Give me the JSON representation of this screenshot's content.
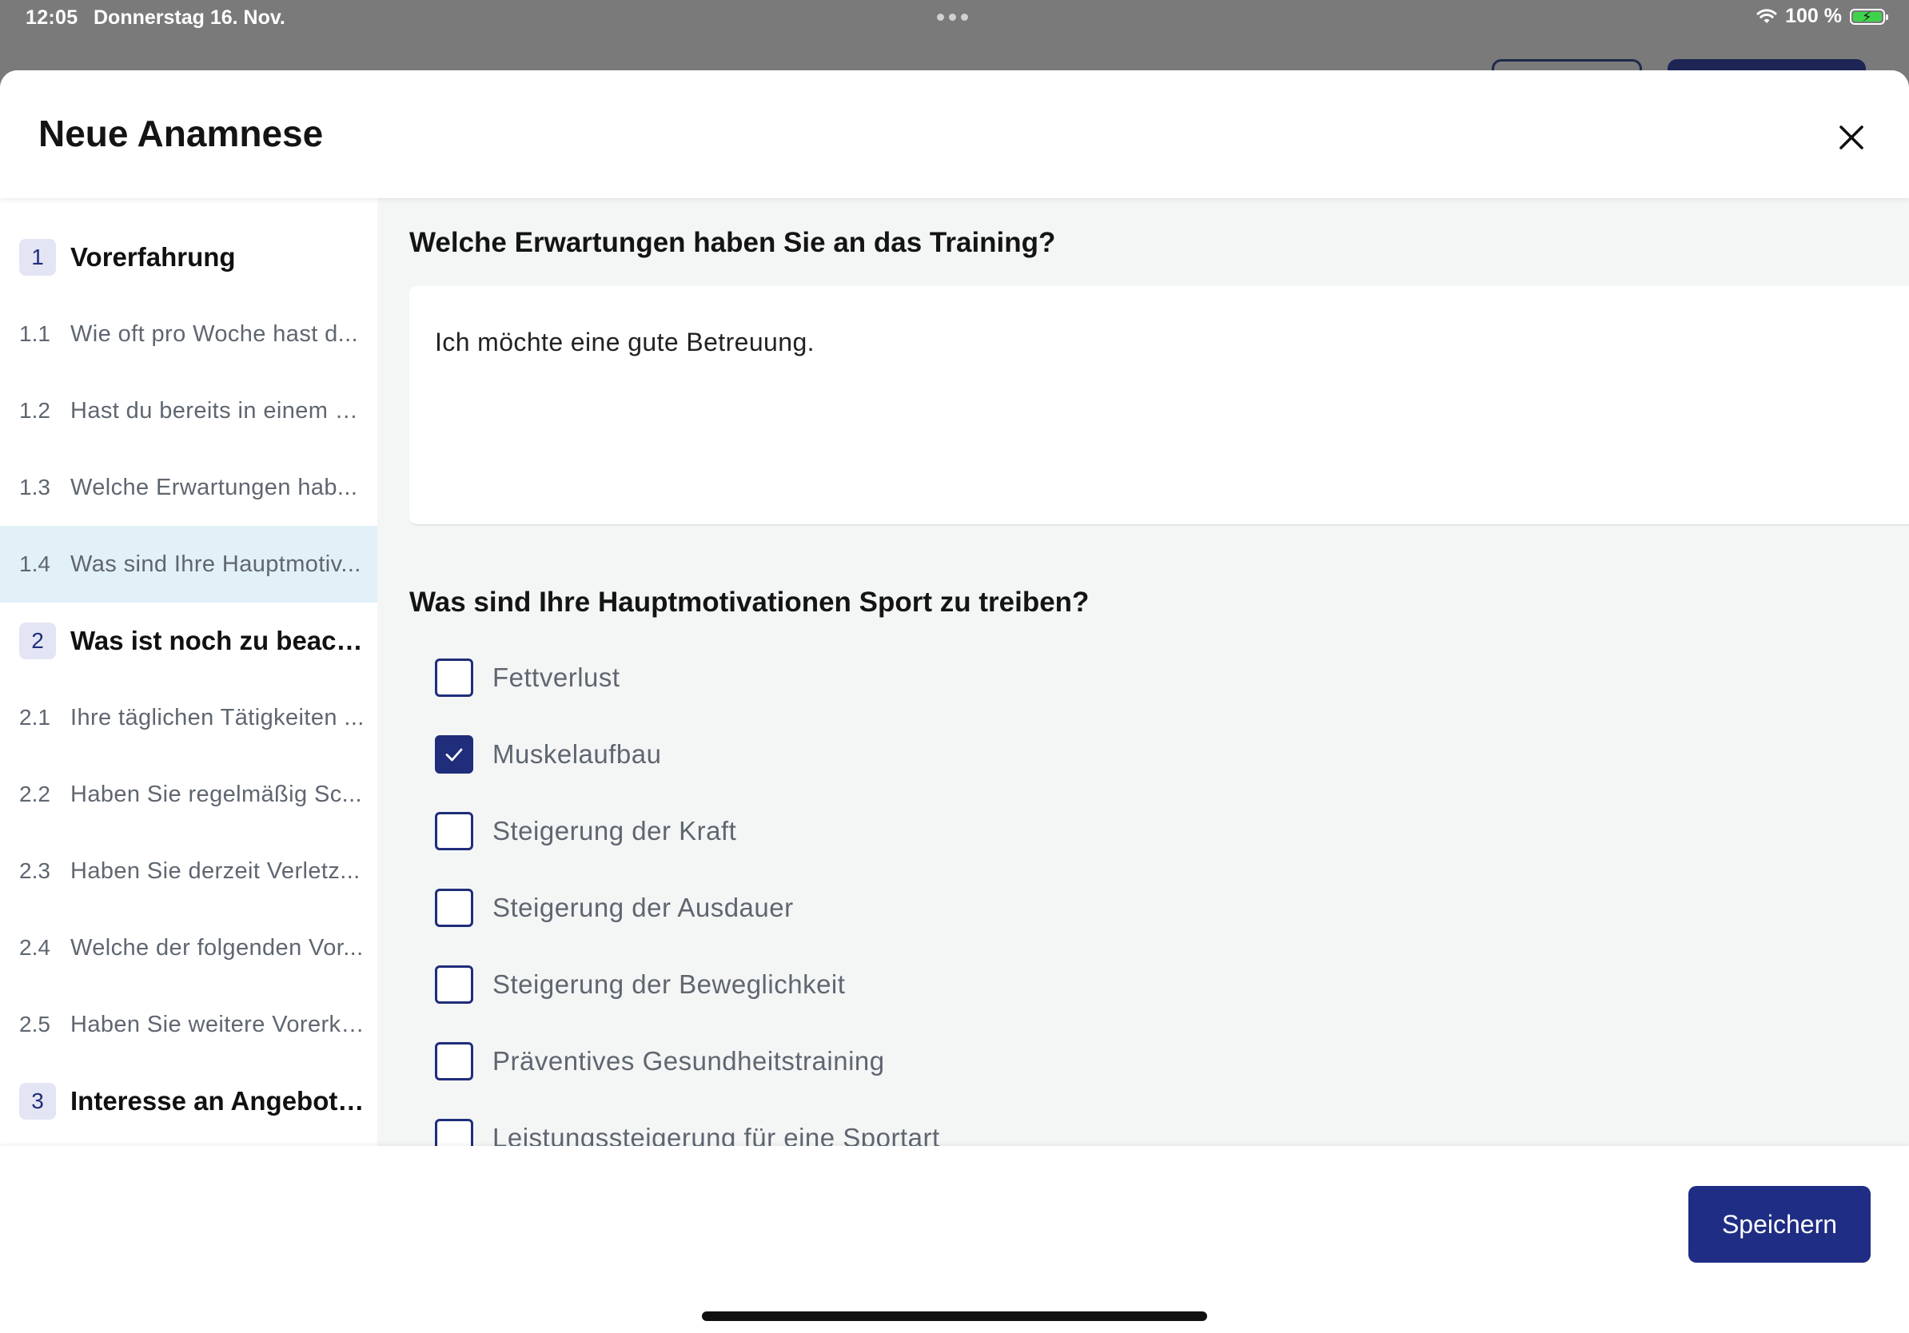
{
  "status_bar": {
    "time": "12:05",
    "date": "Donnerstag 16. Nov.",
    "battery_text": "100 %",
    "icons": [
      "wifi-icon",
      "battery-icon"
    ]
  },
  "sheet": {
    "title": "Neue Anamnese",
    "close_icon": "close-icon"
  },
  "sidebar": {
    "items": [
      {
        "kind": "section",
        "num": "1",
        "label": "Vorerfahrung"
      },
      {
        "kind": "question",
        "num": "1.1",
        "label": "Wie oft pro Woche hast d..."
      },
      {
        "kind": "question",
        "num": "1.2",
        "label": "Hast du bereits in einem F..."
      },
      {
        "kind": "question",
        "num": "1.3",
        "label": "Welche Erwartungen hab..."
      },
      {
        "kind": "question",
        "num": "1.4",
        "label": "Was sind Ihre Hauptmotiv...",
        "active": true
      },
      {
        "kind": "section",
        "num": "2",
        "label": "Was ist noch zu beachten"
      },
      {
        "kind": "question",
        "num": "2.1",
        "label": "Ihre täglichen Tätigkeiten ..."
      },
      {
        "kind": "question",
        "num": "2.2",
        "label": "Haben Sie regelmäßig Sc..."
      },
      {
        "kind": "question",
        "num": "2.3",
        "label": "Haben Sie derzeit Verletz..."
      },
      {
        "kind": "question",
        "num": "2.4",
        "label": "Welche der folgenden Vor..."
      },
      {
        "kind": "question",
        "num": "2.5",
        "label": "Haben Sie weitere Vorerkr..."
      },
      {
        "kind": "section",
        "num": "3",
        "label": "Interesse an Angeboten"
      }
    ]
  },
  "main": {
    "question_expectations": {
      "title": "Welche Erwartungen haben Sie an das Training?",
      "answer": "Ich möchte eine gute Betreuung."
    },
    "question_motivation": {
      "title": "Was sind Ihre Hauptmotivationen Sport zu treiben?",
      "options": [
        {
          "label": "Fettverlust",
          "checked": false
        },
        {
          "label": "Muskelaufbau",
          "checked": true
        },
        {
          "label": "Steigerung der Kraft",
          "checked": false
        },
        {
          "label": "Steigerung der Ausdauer",
          "checked": false
        },
        {
          "label": "Steigerung der Beweglichkeit",
          "checked": false
        },
        {
          "label": "Präventives Gesundheitstraining",
          "checked": false
        },
        {
          "label": "Leistungssteigerung für eine Sportart",
          "checked": false
        }
      ]
    }
  },
  "footer": {
    "save_label": "Speichern"
  },
  "colors": {
    "primary": "#1f2d84",
    "active_item_bg": "#e2f1f7",
    "content_bg": "#f4f6f6",
    "badge_bg": "#e3e5f4"
  }
}
